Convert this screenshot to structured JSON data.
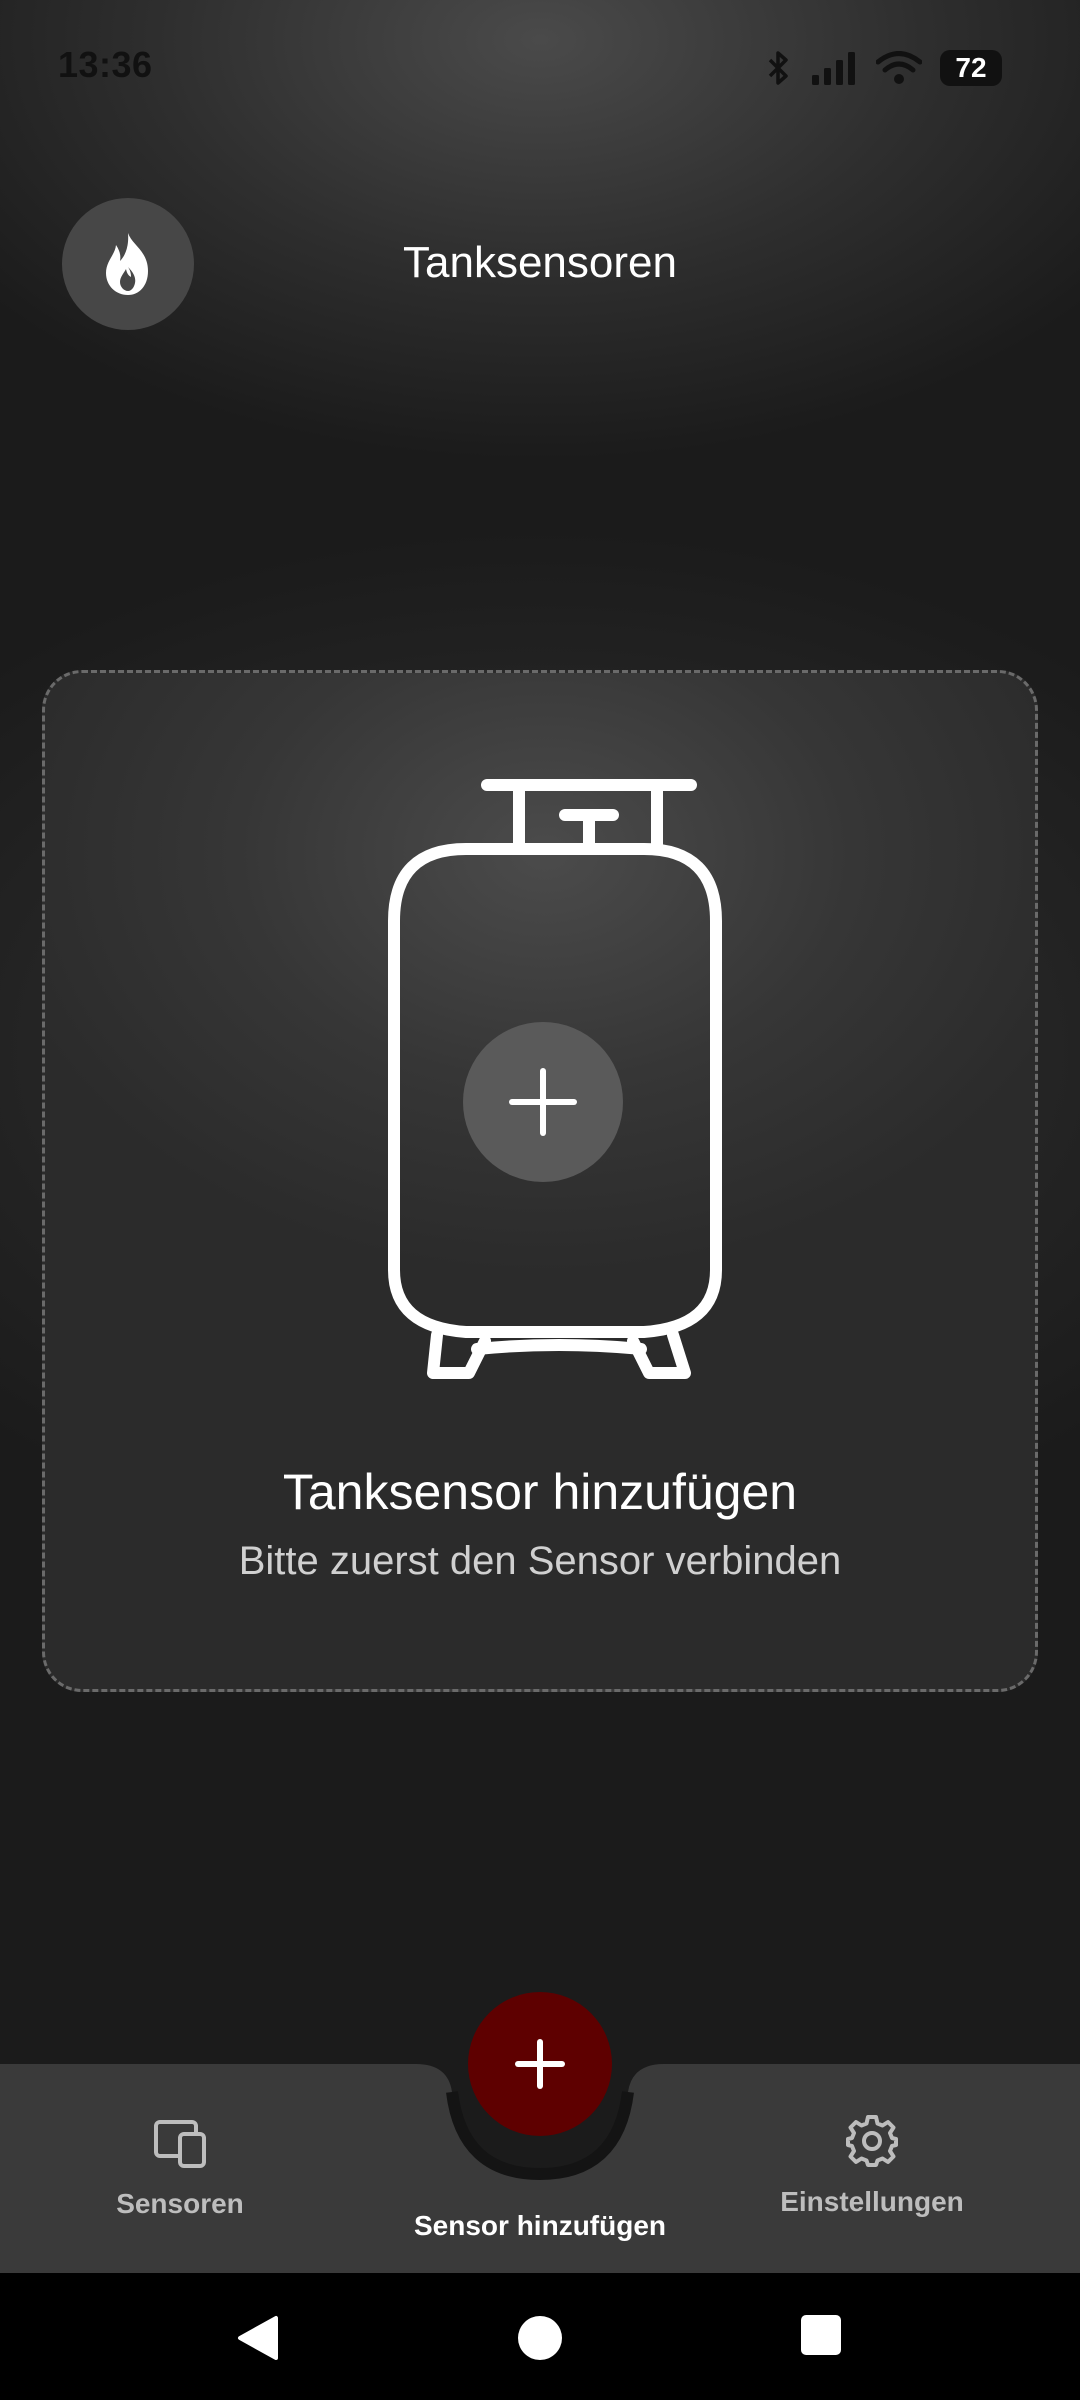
{
  "status_bar": {
    "time": "13:36",
    "battery": "72",
    "icons": [
      "bluetooth-icon",
      "signal-icon",
      "wifi-icon"
    ]
  },
  "header": {
    "logo_icon": "flame-icon",
    "title": "Tanksensoren"
  },
  "add_card": {
    "illustration": "gas-tank-icon",
    "plus_icon": "plus-icon",
    "title": "Tanksensor hinzufügen",
    "subtitle": "Bitte zuerst den Sensor verbinden"
  },
  "bottom_nav": {
    "items": [
      {
        "label": "Sensoren",
        "icon": "devices-icon"
      },
      {
        "label": "Sensor hinzufügen",
        "icon": "plus-icon",
        "active": true
      },
      {
        "label": "Einstellungen",
        "icon": "gear-icon"
      }
    ]
  },
  "system_nav": {
    "buttons": [
      "back-icon",
      "home-icon",
      "recents-icon"
    ]
  },
  "colors": {
    "accent": "#5e0000",
    "nav_background": "#3a3a3a",
    "text_primary": "#ffffff",
    "text_secondary": "#bdbdbd"
  }
}
